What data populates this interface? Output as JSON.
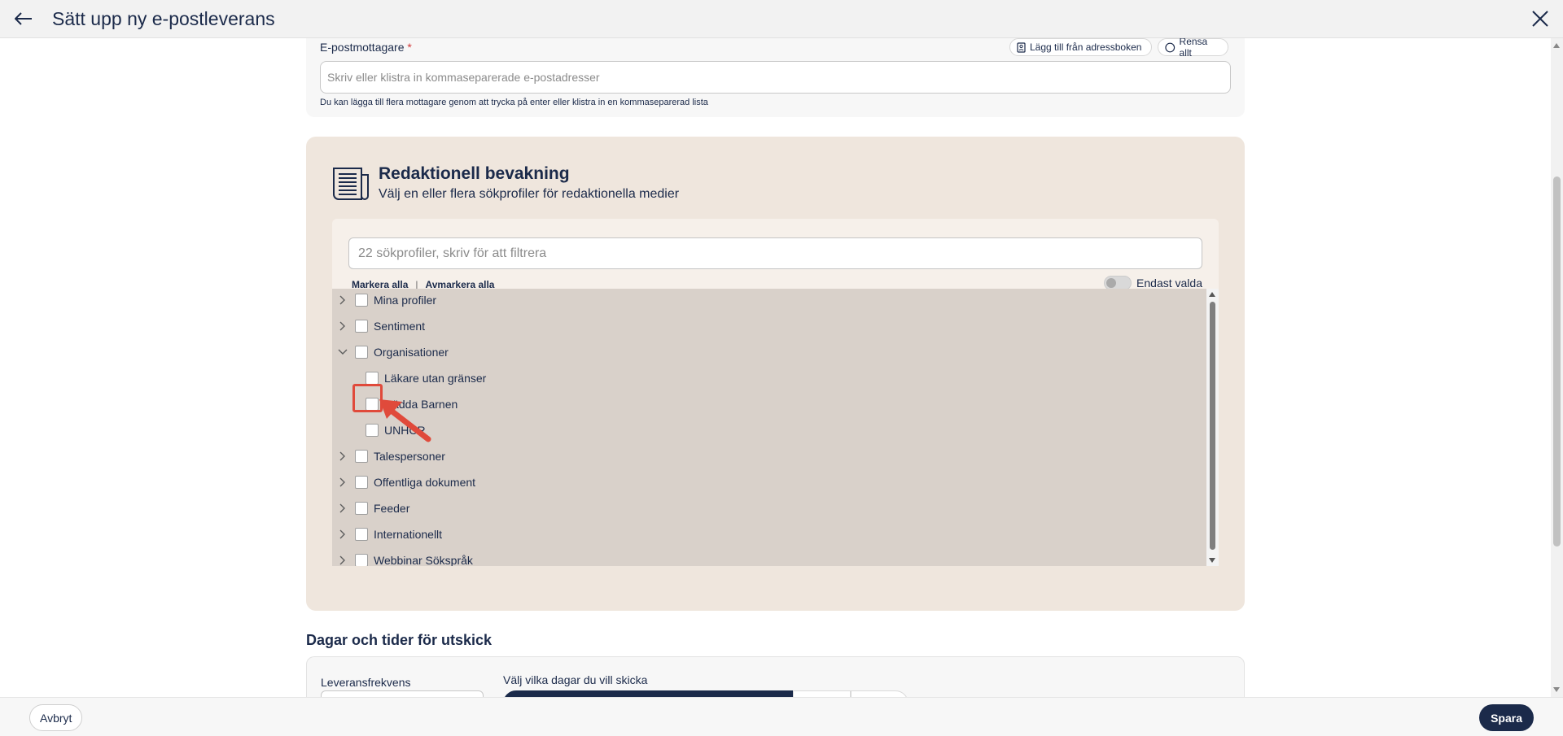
{
  "header": {
    "title": "Sätt upp ny e-postleverans"
  },
  "recipients": {
    "label": "E-postmottagare",
    "required_marker": "*",
    "add_from_addressbook_label": "Lägg till från adressboken",
    "clear_all_label": "Rensa allt",
    "input_placeholder": "Skriv eller klistra in kommaseparerade e-postadresser",
    "input_value": "",
    "help_text": "Du kan lägga till flera mottagare genom att trycka på enter eller klistra in en kommaseparerad lista"
  },
  "editorial": {
    "title": "Redaktionell bevakning",
    "subtitle": "Välj en eller flera sökprofiler för redaktionella medier",
    "filter_placeholder": "22 sökprofiler, skriv för att filtrera",
    "select_all_label": "Markera alla",
    "separator": "|",
    "deselect_all_label": "Avmarkera alla",
    "only_selected_label": "Endast valda",
    "only_selected_on": false,
    "tree": [
      {
        "label": "Mina profiler",
        "level": 0,
        "expanded": false,
        "checked": false
      },
      {
        "label": "Sentiment",
        "level": 0,
        "expanded": false,
        "checked": false
      },
      {
        "label": "Organisationer",
        "level": 0,
        "expanded": true,
        "checked": false
      },
      {
        "label": "Läkare utan gränser",
        "level": 1,
        "checked": false
      },
      {
        "label": "Rädda Barnen",
        "level": 1,
        "checked": false
      },
      {
        "label": "UNHCR",
        "level": 1,
        "checked": false
      },
      {
        "label": "Talespersoner",
        "level": 0,
        "expanded": false,
        "checked": false
      },
      {
        "label": "Offentliga dokument",
        "level": 0,
        "expanded": false,
        "checked": false
      },
      {
        "label": "Feeder",
        "level": 0,
        "expanded": false,
        "checked": false
      },
      {
        "label": "Internationellt",
        "level": 0,
        "expanded": false,
        "checked": false
      },
      {
        "label": "Webbinar Sökspråk",
        "level": 0,
        "expanded": false,
        "checked": false
      }
    ]
  },
  "schedule": {
    "title": "Dagar och tider för utskick",
    "frequency_label": "Leveransfrekvens",
    "days_label": "Välj vilka dagar du vill skicka"
  },
  "footer": {
    "cancel_label": "Avbryt",
    "save_label": "Spara"
  },
  "colors": {
    "primary": "#1b2a4a",
    "editorial_background": "#efe6dd",
    "tree_background": "#d9d1ca",
    "annotation": "#e04a3b"
  }
}
